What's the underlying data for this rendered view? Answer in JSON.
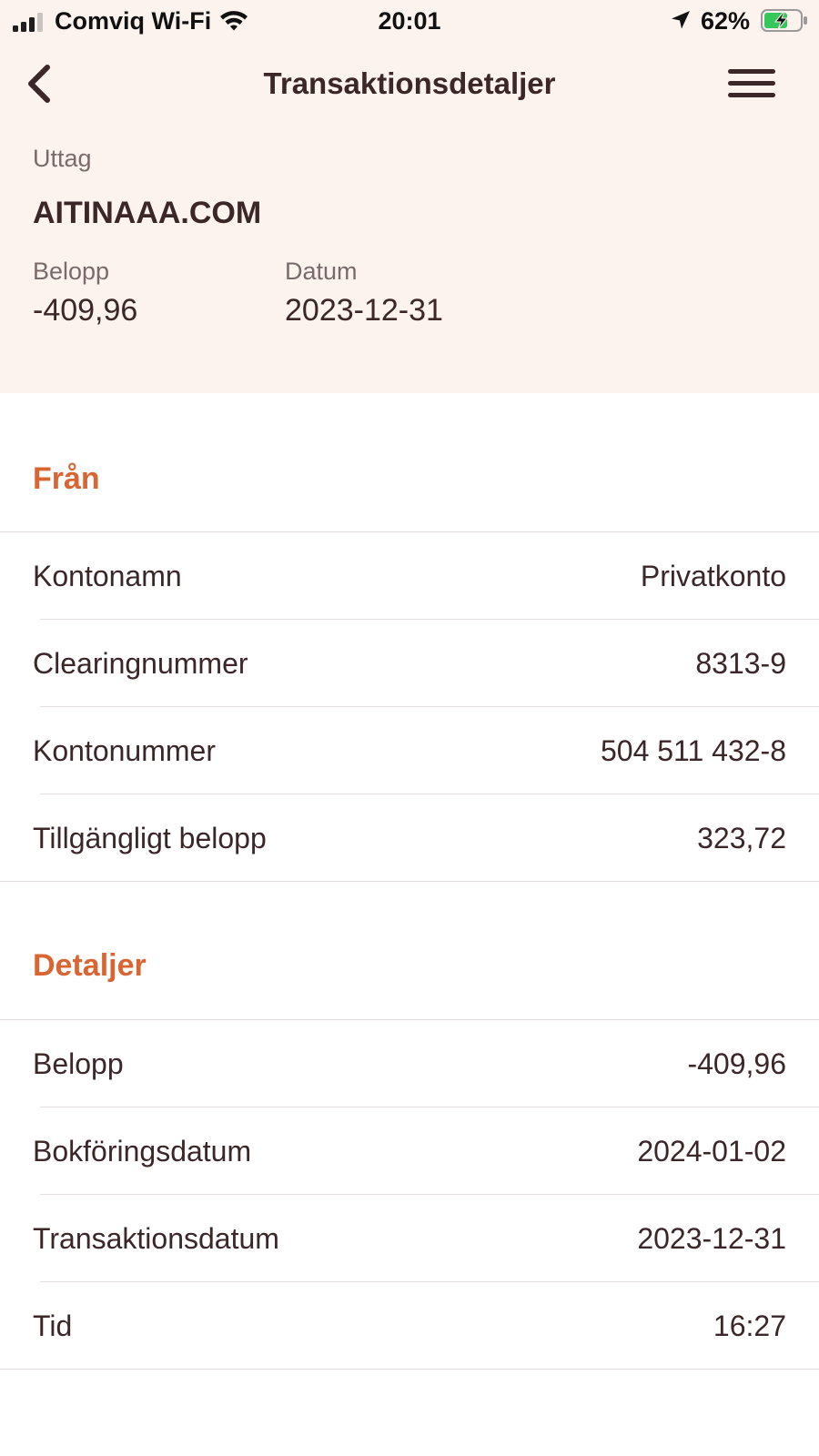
{
  "status_bar": {
    "carrier": "Comviq Wi-Fi",
    "time": "20:01",
    "battery_percent": "62%",
    "signal_bars": 4,
    "signal_bars_filled": 3
  },
  "nav": {
    "title": "Transaktionsdetaljer",
    "back_icon": "chevron-left-icon",
    "menu_icon": "hamburger-menu-icon"
  },
  "summary": {
    "type": "Uttag",
    "merchant": "AITINAAA.COM",
    "amount_label": "Belopp",
    "amount_value": "-409,96",
    "date_label": "Datum",
    "date_value": "2023-12-31"
  },
  "from_section": {
    "title": "Från",
    "rows": [
      {
        "label": "Kontonamn",
        "value": "Privatkonto"
      },
      {
        "label": "Clearingnummer",
        "value": "8313-9"
      },
      {
        "label": "Kontonummer",
        "value": "504 511 432-8"
      },
      {
        "label": "Tillgängligt belopp",
        "value": "323,72"
      }
    ]
  },
  "details_section": {
    "title": "Detaljer",
    "rows": [
      {
        "label": "Belopp",
        "value": "-409,96"
      },
      {
        "label": "Bokföringsdatum",
        "value": "2024-01-02"
      },
      {
        "label": "Transaktionsdatum",
        "value": "2023-12-31"
      },
      {
        "label": "Tid",
        "value": "16:27"
      }
    ]
  },
  "colors": {
    "header_bg": "#fcf3ef",
    "accent": "#d96532",
    "text": "#3b2628",
    "muted": "#7a6a6b"
  }
}
